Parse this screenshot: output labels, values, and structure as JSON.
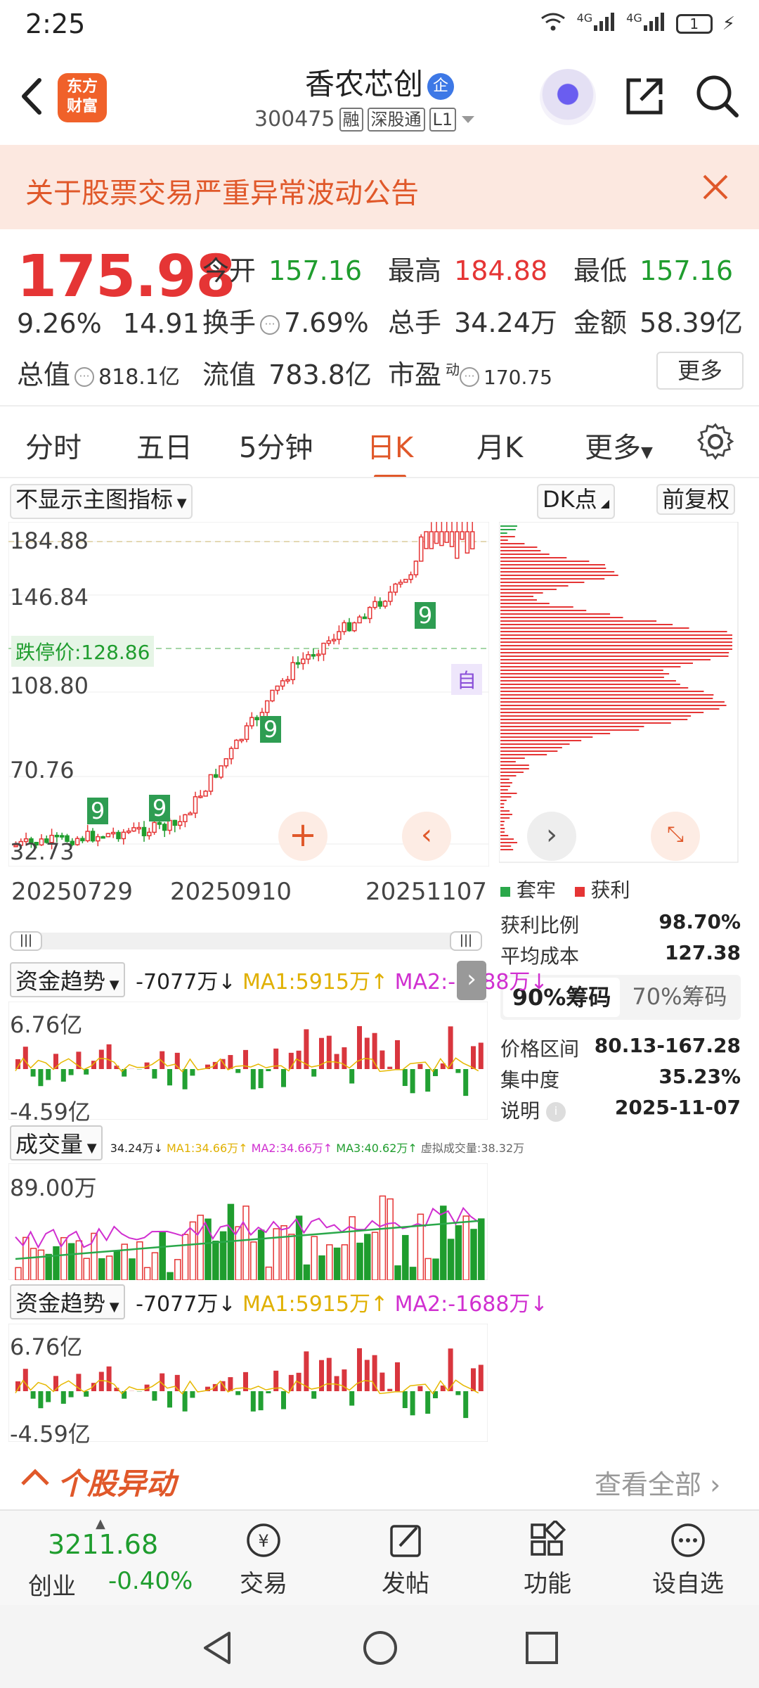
{
  "status": {
    "time": "2:25",
    "net1": "4G",
    "net2": "4G",
    "battery": "1"
  },
  "header": {
    "name": "香农芯创",
    "badge": "企",
    "code": "300475",
    "tags": [
      "融",
      "深股通",
      "L1"
    ],
    "logo_line1": "东方",
    "logo_line2": "财富"
  },
  "notice": {
    "text": "关于股票交易严重异常波动公告"
  },
  "quote": {
    "price": "175.98",
    "change_pct": "9.26%",
    "change": "14.91",
    "open_label": "今开",
    "open": "157.16",
    "high_label": "最高",
    "high": "184.88",
    "low_label": "最低",
    "low": "157.16",
    "turnover_label": "换手",
    "turnover": "7.69%",
    "volume_label": "总手",
    "volume": "34.24万",
    "amount_label": "金额",
    "amount": "58.39亿",
    "mktcap_label": "总值",
    "mktcap": "818.1亿",
    "float_label": "流值",
    "float": "783.8亿",
    "pe_label": "市盈",
    "pe_sup": "动",
    "pe": "170.75",
    "more": "更多"
  },
  "tabs": [
    {
      "label": "分时"
    },
    {
      "label": "五日"
    },
    {
      "label": "5分钟"
    },
    {
      "label": "日K"
    },
    {
      "label": "月K"
    },
    {
      "label": "更多"
    }
  ],
  "kchart": {
    "indicator_select": "不显示主图指标",
    "dk_select": "DK点",
    "fuquan": "前复权",
    "y_labels": [
      "184.88",
      "146.84",
      "108.80",
      "70.76",
      "32.73"
    ],
    "limit_down": "跌停价:128.86",
    "x_labels": [
      "20250729",
      "20250910",
      "20251107"
    ],
    "auto_tag": "自",
    "markers": [
      "9",
      "9",
      "9",
      "9"
    ]
  },
  "chips": {
    "legend_trap": "套牢",
    "legend_profit": "获利",
    "rows": [
      {
        "label": "获利比例",
        "value": "98.70%"
      },
      {
        "label": "平均成本",
        "value": "127.38"
      }
    ],
    "tab90": "90%筹码",
    "tab70": "70%筹码",
    "rows2": [
      {
        "label": "价格区间",
        "value": "80.13-167.28"
      },
      {
        "label": "集中度",
        "value": "35.23%"
      },
      {
        "label": "说明",
        "value": "2025-11-07"
      }
    ]
  },
  "fund1": {
    "select": "资金趋势",
    "val": "-7077万↓",
    "ma1": "MA1:5915万↑",
    "ma2": "MA2:-1688万↓",
    "ymax": "6.76亿",
    "ymin": "-4.59亿"
  },
  "volume": {
    "select": "成交量",
    "legend": "34.24万↓",
    "ma1": "MA1:34.66万↑",
    "ma2": "MA2:34.66万↑",
    "ma3": "MA3:40.62万↑",
    "virtual": "虚拟成交量:38.32万",
    "ymax": "89.00万"
  },
  "fund2": {
    "select": "资金趋势",
    "val": "-7077万↓",
    "ma1": "MA1:5915万↑",
    "ma2": "MA2:-1688万↓",
    "ymax": "6.76亿",
    "ymin": "-4.59亿"
  },
  "movers": {
    "title": "个股异动",
    "link": "查看全部"
  },
  "bottomnav": {
    "index_value": "3211.68",
    "index_name": "创业",
    "index_change": "-0.40%",
    "items": [
      {
        "label": "交易"
      },
      {
        "label": "发帖"
      },
      {
        "label": "功能"
      },
      {
        "label": "设自选"
      }
    ]
  },
  "colors": {
    "accent": "#e0582a",
    "up": "#e53535",
    "down": "#1f9d2e"
  }
}
